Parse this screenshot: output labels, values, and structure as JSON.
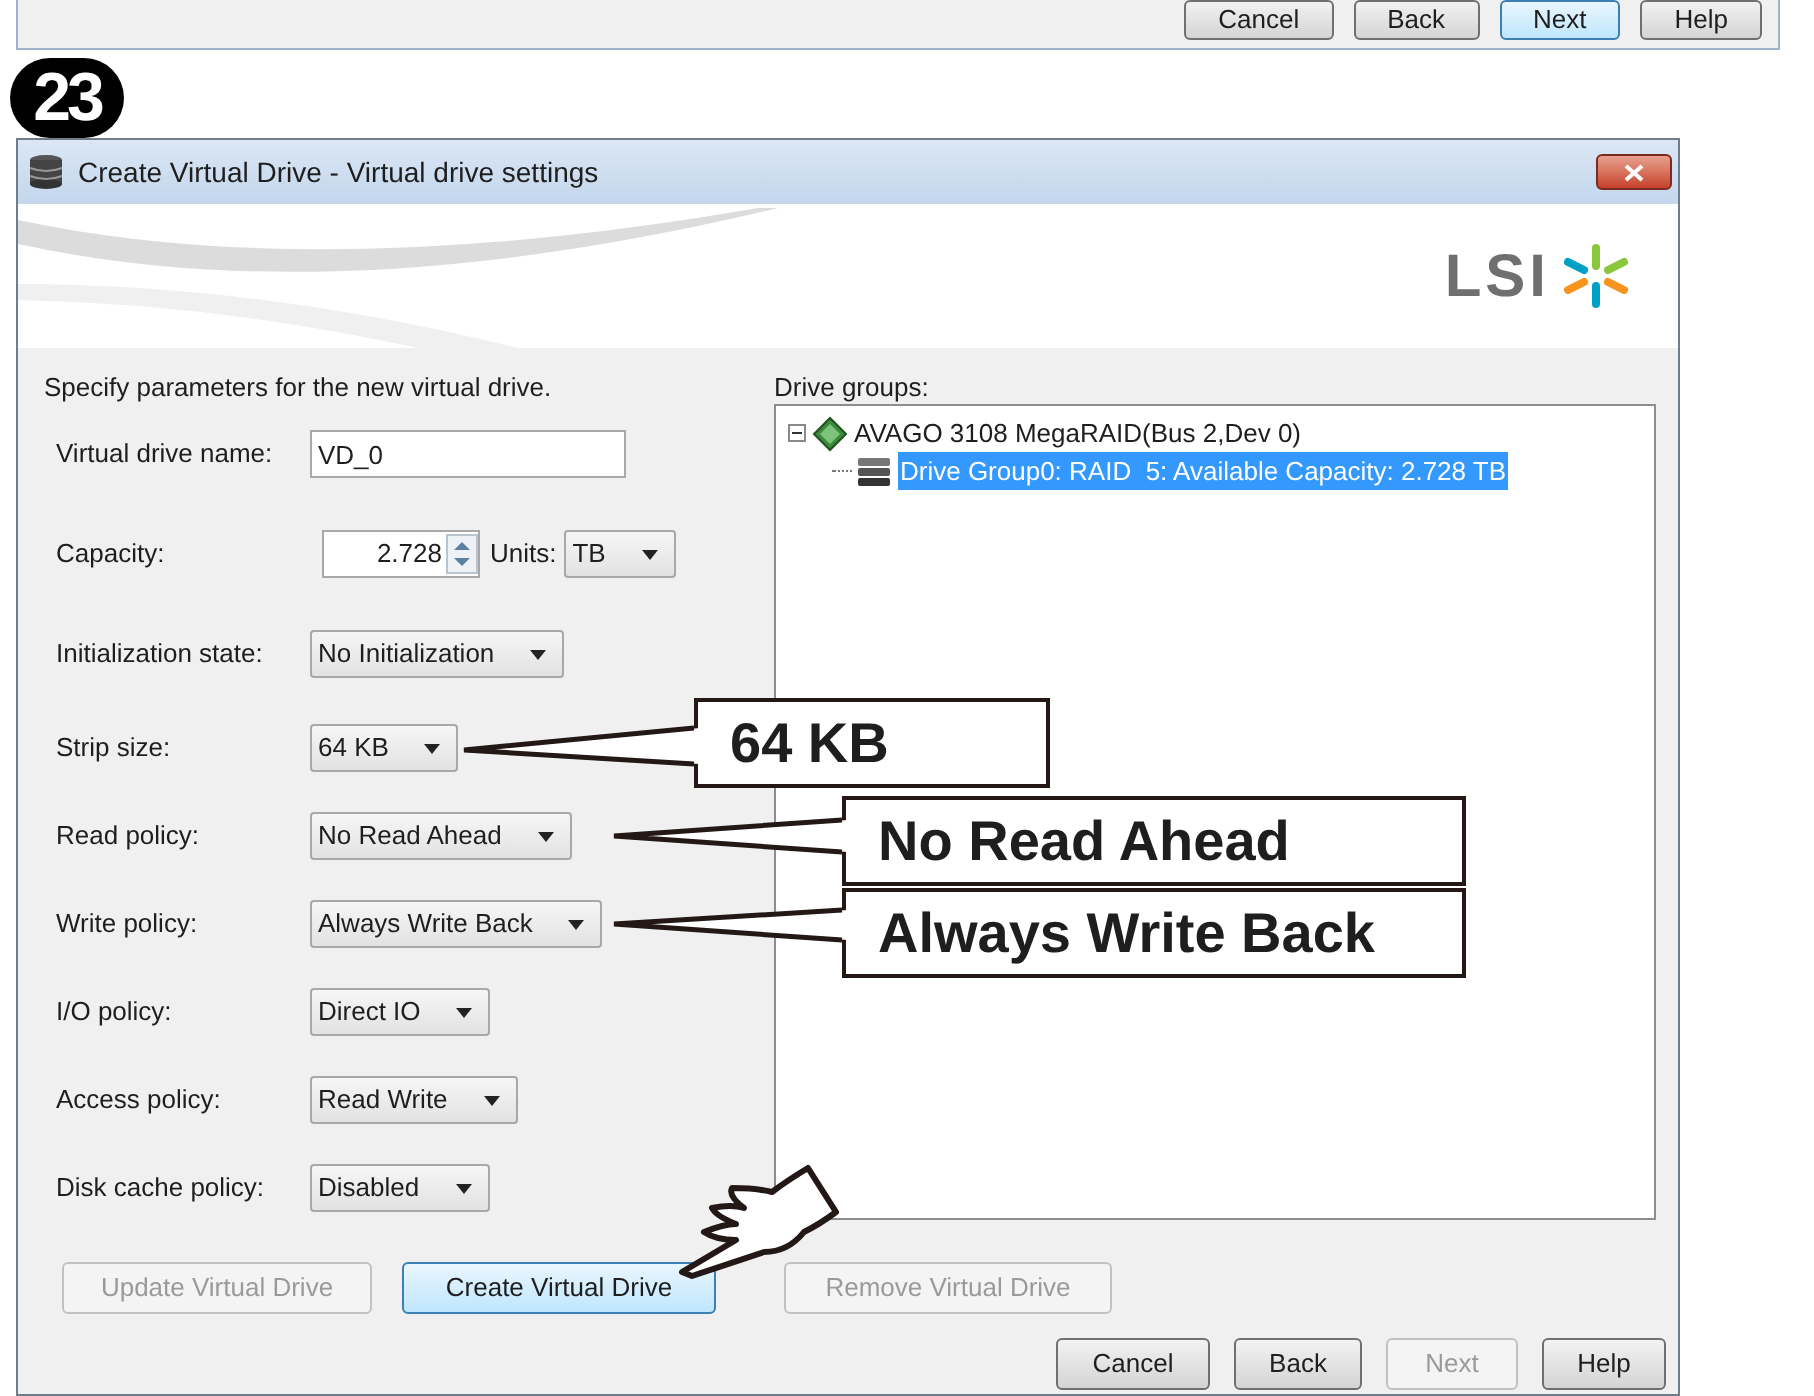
{
  "background_window": {
    "buttons": [
      {
        "label": "Cancel",
        "disabled": false,
        "focused": false
      },
      {
        "label": "Back",
        "disabled": false,
        "focused": false
      },
      {
        "label": "Next",
        "disabled": false,
        "focused": true
      },
      {
        "label": "Help",
        "disabled": false,
        "focused": false
      }
    ]
  },
  "step_badge": "23",
  "window": {
    "title": "Create Virtual Drive - Virtual drive settings",
    "logo": "LSI"
  },
  "instructions": "Specify parameters for the new virtual drive.",
  "fields": [
    {
      "label": "Virtual drive name:",
      "kind": "text",
      "value": "VD_0"
    },
    {
      "label": "Capacity:",
      "kind": "spinner",
      "value": "2.728",
      "units_label": "Units:",
      "units_value": "TB"
    },
    {
      "label": "Initialization state:",
      "kind": "dropdown",
      "value": "No Initialization"
    },
    {
      "label": "Strip size:",
      "kind": "dropdown",
      "value": "64 KB"
    },
    {
      "label": "Read policy:",
      "kind": "dropdown",
      "value": "No Read Ahead"
    },
    {
      "label": "Write policy:",
      "kind": "dropdown",
      "value": "Always Write Back"
    },
    {
      "label": "I/O policy:",
      "kind": "dropdown",
      "value": "Direct IO"
    },
    {
      "label": "Access policy:",
      "kind": "dropdown",
      "value": "Read Write"
    },
    {
      "label": "Disk cache policy:",
      "kind": "dropdown",
      "value": "Disabled"
    }
  ],
  "drive_groups": {
    "label": "Drive groups:",
    "tree": [
      {
        "label": "AVAGO 3108 MegaRAID(Bus 2,Dev 0)",
        "expanded": true,
        "selected": false,
        "children": [
          {
            "label": "Drive Group0: RAID  5: Available Capacity: 2.728 TB",
            "selected": true
          }
        ]
      }
    ]
  },
  "action_buttons": [
    {
      "label": "Update Virtual Drive",
      "disabled": true,
      "focused": false
    },
    {
      "label": "Create Virtual Drive",
      "disabled": false,
      "focused": true
    },
    {
      "label": "Remove Virtual Drive",
      "disabled": true,
      "focused": false
    }
  ],
  "dialog_buttons": [
    {
      "label": "Cancel",
      "disabled": false,
      "focused": false
    },
    {
      "label": "Back",
      "disabled": false,
      "focused": false
    },
    {
      "label": "Next",
      "disabled": true,
      "focused": false
    },
    {
      "label": "Help",
      "disabled": false,
      "focused": false
    }
  ],
  "callouts": [
    {
      "text": "64 KB"
    },
    {
      "text": "No Read Ahead"
    },
    {
      "text": "Always Write Back"
    }
  ]
}
